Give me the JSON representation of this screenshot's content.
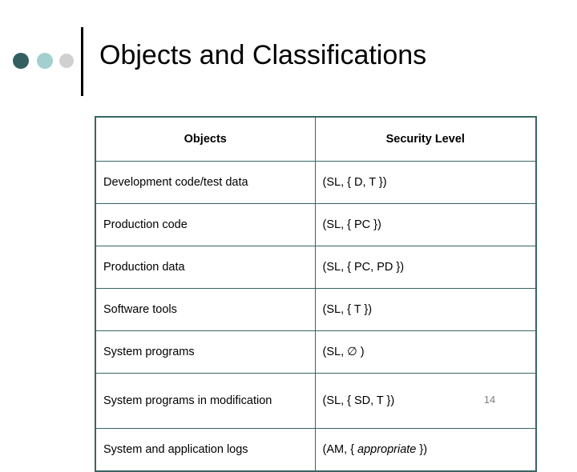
{
  "slide": {
    "title": "Objects and Classifications",
    "page_number": "14",
    "decor": {
      "dot1_color": "#33605f",
      "dot2_color": "#a3cfcf",
      "dot3_color": "#d0d0d0",
      "rule_color": "#000000",
      "table_border_color": "#3a6464"
    }
  },
  "table": {
    "headers": {
      "objects": "Objects",
      "security_level": "Security Level"
    },
    "rows": [
      {
        "object": "Development code/test data",
        "level_prefix": "(SL, { D, T })",
        "level_italic": "",
        "level_suffix": ""
      },
      {
        "object": "Production code",
        "level_prefix": "(SL, { PC })",
        "level_italic": "",
        "level_suffix": ""
      },
      {
        "object": "Production data",
        "level_prefix": "(SL, { PC, PD })",
        "level_italic": "",
        "level_suffix": ""
      },
      {
        "object": "Software tools",
        "level_prefix": "(SL, { T })",
        "level_italic": "",
        "level_suffix": ""
      },
      {
        "object": "System programs",
        "level_prefix": "(SL, ∅ )",
        "level_italic": "",
        "level_suffix": ""
      },
      {
        "object": "System programs in modification",
        "level_prefix": "(SL, { SD, T })",
        "level_italic": "",
        "level_suffix": ""
      },
      {
        "object": "System and application logs",
        "level_prefix": "(AM, { ",
        "level_italic": "appropriate",
        "level_suffix": " })"
      }
    ]
  }
}
